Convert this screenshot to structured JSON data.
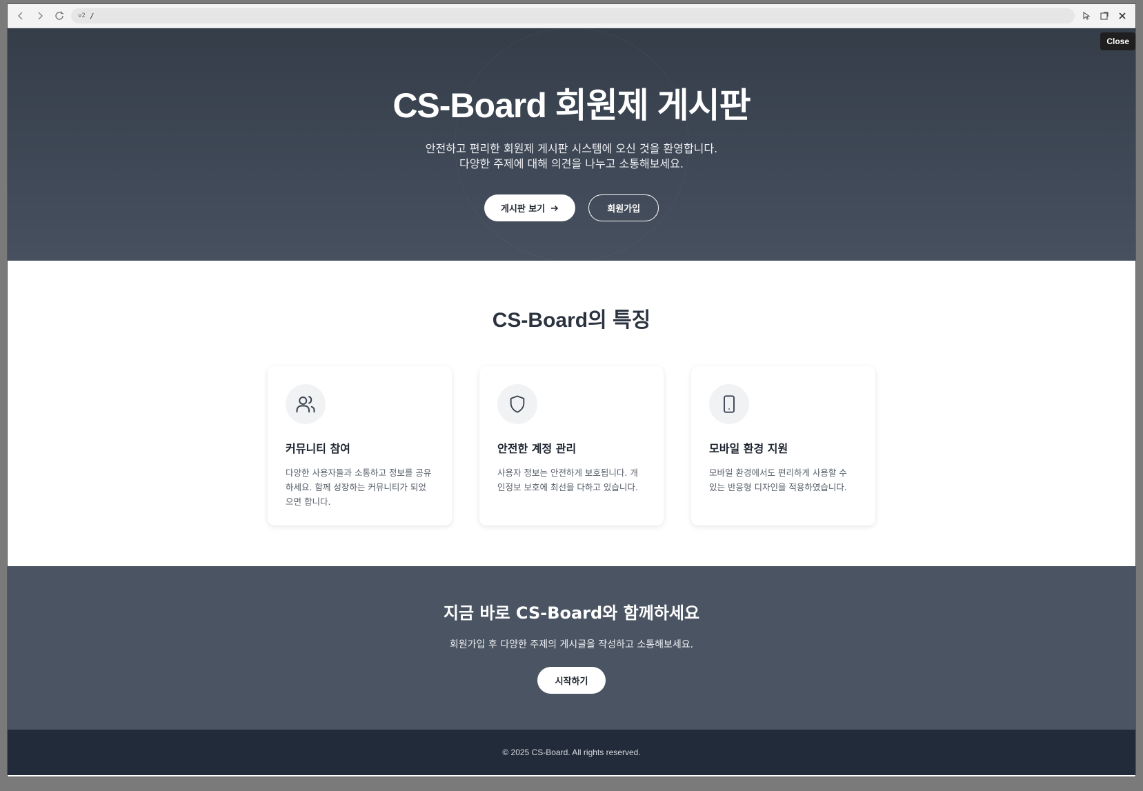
{
  "browser": {
    "url_badge": "ν2",
    "url": "/",
    "tooltip": "Close",
    "icons": [
      "back-icon",
      "forward-icon",
      "reload-icon",
      "cursor-icon",
      "popout-icon",
      "close-icon"
    ]
  },
  "hero": {
    "title": "CS-Board 회원제 게시판",
    "subtitle_line1": "안전하고 편리한 회원제 게시판 시스템에 오신 것을 환영합니다.",
    "subtitle_line2": "다양한 주제에 대해 의견을 나누고 소통해보세요.",
    "primary_button": "게시판 보기",
    "secondary_button": "회원가입"
  },
  "features": {
    "title": "CS-Board의 특징",
    "cards": [
      {
        "icon": "users-icon",
        "title": "커뮤니티 참여",
        "text": "다양한 사용자들과 소통하고 정보를 공유하세요. 함께 성장하는 커뮤니티가 되었으면 합니다."
      },
      {
        "icon": "shield-icon",
        "title": "안전한 계정 관리",
        "text": "사용자 정보는 안전하게 보호됩니다. 개인정보 보호에 최선을 다하고 있습니다."
      },
      {
        "icon": "mobile-icon",
        "title": "모바일 환경 지원",
        "text": "모바일 환경에서도 편리하게 사용할 수 있는 반응형 디자인을 적용하였습니다."
      }
    ]
  },
  "cta": {
    "title": "지금 바로 CS-Board와 함께하세요",
    "subtitle": "회원가입 후 다양한 주제의 게시글을 작성하고 소통해보세요.",
    "button": "시작하기"
  },
  "footer": {
    "copyright": "© 2025 CS-Board. All rights reserved."
  },
  "colors": {
    "hero_bg": "#3b4350",
    "cta_bg": "#4a5462",
    "footer_bg": "#222b39",
    "text_dark": "#1d2430"
  }
}
